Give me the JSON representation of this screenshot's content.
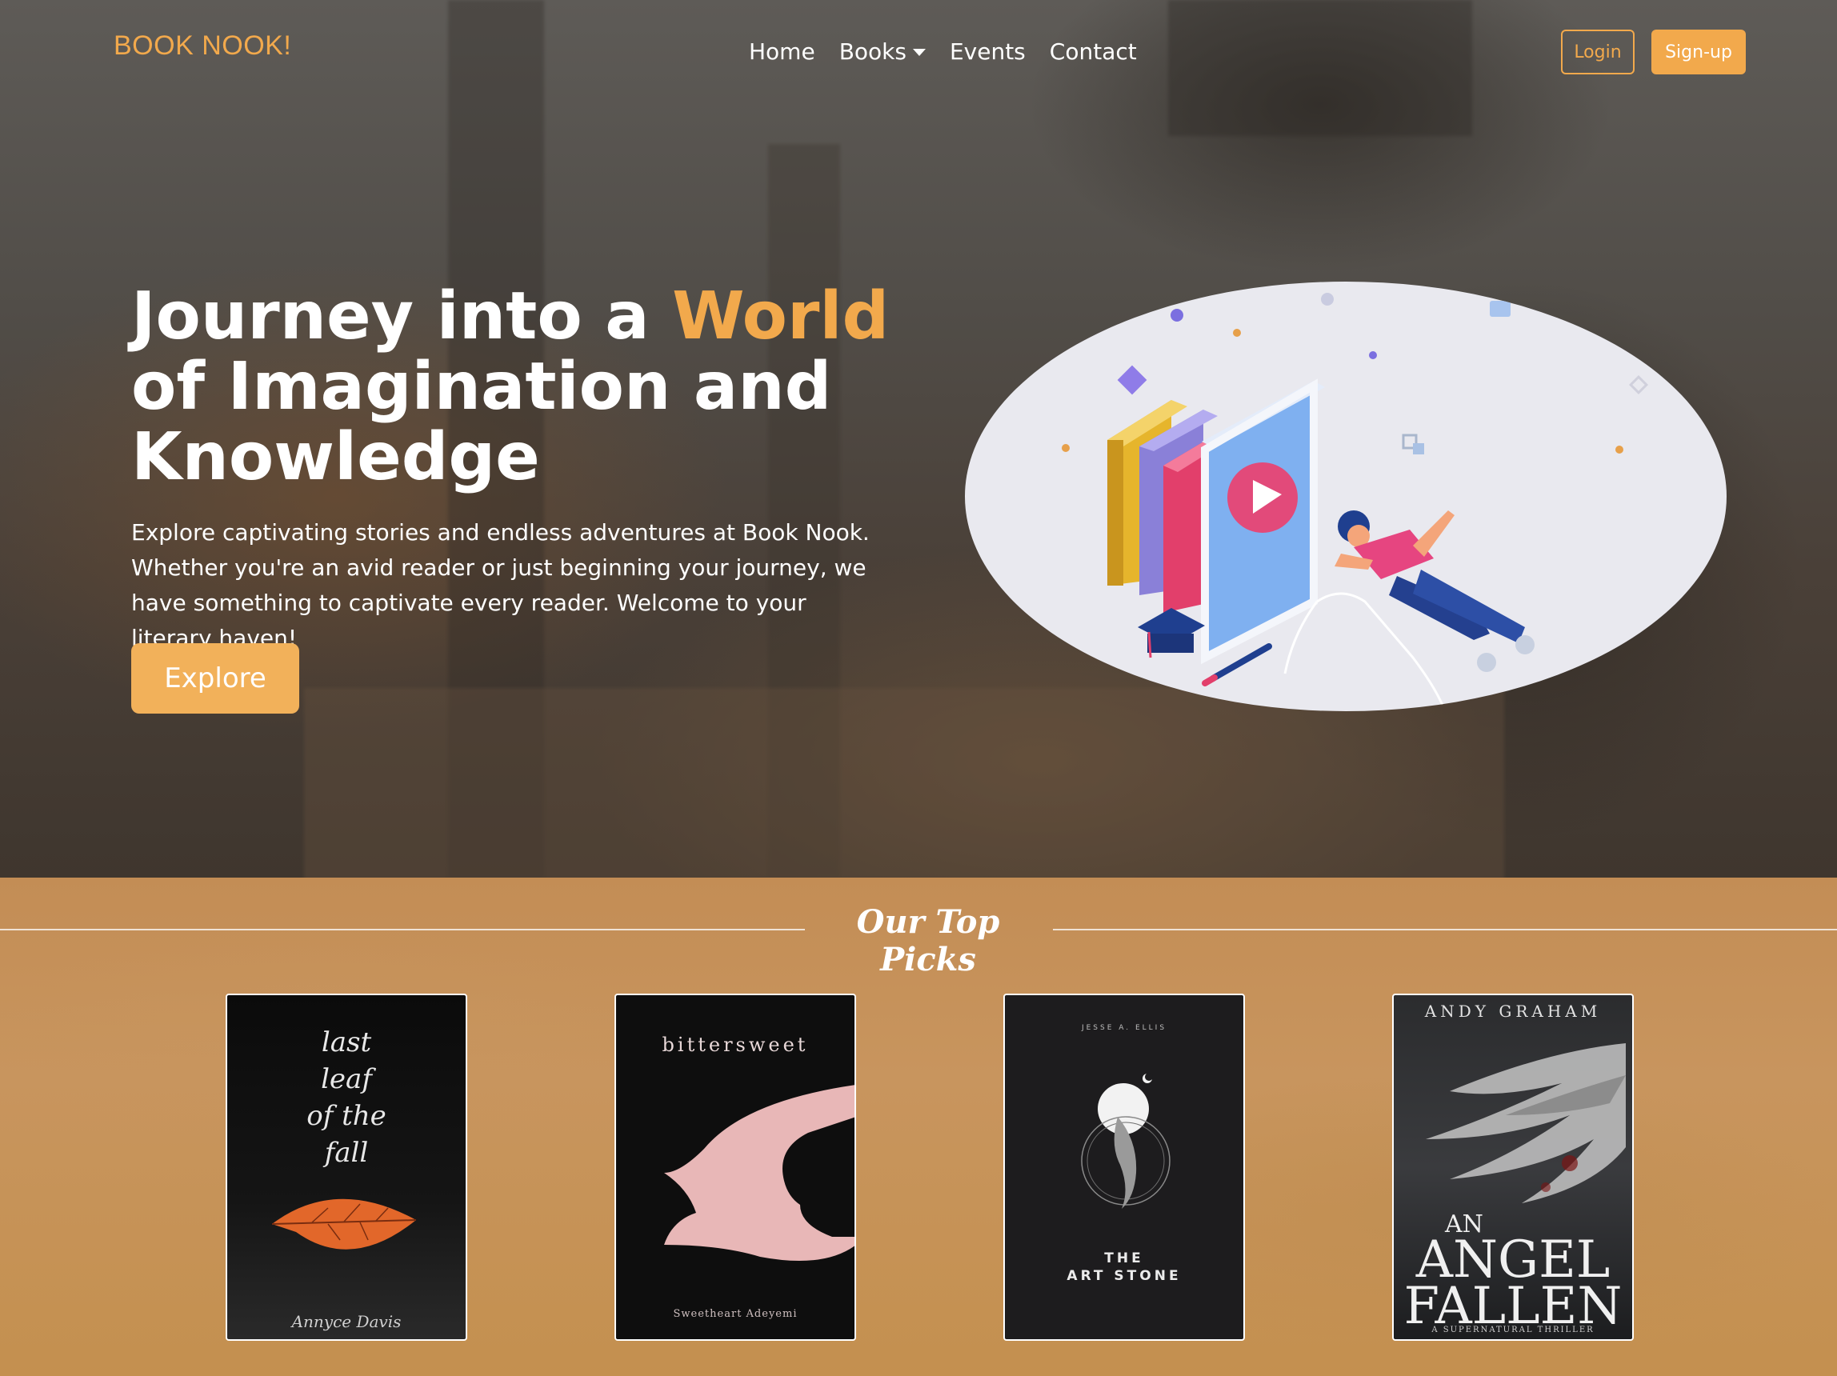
{
  "nav": {
    "brand": "BOOK NOOK!",
    "links": [
      {
        "label": "Home"
      },
      {
        "label": "Books"
      },
      {
        "label": "Events"
      },
      {
        "label": "Contact"
      }
    ],
    "login_label": "Login",
    "signup_label": "Sign-up"
  },
  "hero": {
    "title_part1": "Journey into a ",
    "title_accent": "World",
    "title_part2": "of Imagination and",
    "title_part3": "Knowledge",
    "description": "Explore captivating stories and endless adventures at Book Nook. Whether you're an avid reader or just beginning your journey, we have something to captivate every reader. Welcome to your literary haven!",
    "explore_label": "Explore"
  },
  "picks": {
    "title": "Our Top Picks",
    "books": [
      {
        "title_line1": "last",
        "title_line2": "leaf",
        "title_line3": "of the",
        "title_line4": "fall",
        "author": "Annyce Davis"
      },
      {
        "title": "bittersweet",
        "author": "Sweetheart Adeyemi"
      },
      {
        "author_top": "JESSE A. ELLIS",
        "title_line1": "THE",
        "title_line2": "ART STONE"
      },
      {
        "author_top": "ANDY GRAHAM",
        "title_line1": "AN",
        "title_line2": "ANGEL",
        "title_line3": "FALLEN",
        "tagline": "A SUPERNATURAL THRILLER"
      }
    ]
  },
  "colors": {
    "accent": "#f2a94c",
    "picks_background": "#c8955e"
  }
}
